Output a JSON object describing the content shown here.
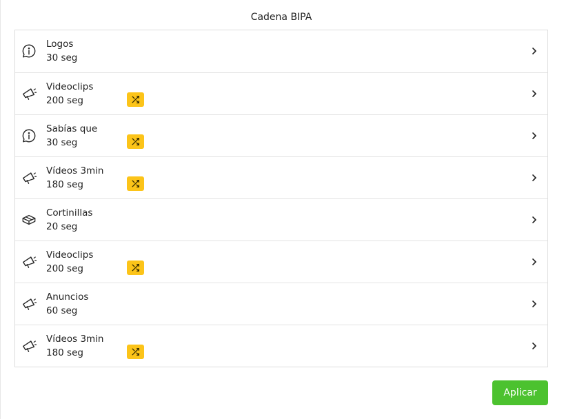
{
  "header": {
    "title": "Cadena BIPA"
  },
  "items": [
    {
      "name": "Logos",
      "duration": "30 seg",
      "icon": "info-icon",
      "shuffle": false
    },
    {
      "name": "Videoclips",
      "duration": "200 seg",
      "icon": "megaphone-icon",
      "shuffle": true
    },
    {
      "name": "Sabías que",
      "duration": "30 seg",
      "icon": "info-icon",
      "shuffle": true
    },
    {
      "name": "Vídeos 3min",
      "duration": "180 seg",
      "icon": "megaphone-icon",
      "shuffle": true
    },
    {
      "name": "Cortinillas",
      "duration": "20 seg",
      "icon": "box-icon",
      "shuffle": false
    },
    {
      "name": "Videoclips",
      "duration": "200 seg",
      "icon": "megaphone-icon",
      "shuffle": true
    },
    {
      "name": "Anuncios",
      "duration": "60 seg",
      "icon": "megaphone-icon",
      "shuffle": false
    },
    {
      "name": "Vídeos 3min",
      "duration": "180 seg",
      "icon": "megaphone-icon",
      "shuffle": true
    }
  ],
  "actions": {
    "apply_label": "Aplicar"
  },
  "colors": {
    "accent_green": "#4cc22f",
    "shuffle_badge": "#fcc419"
  }
}
